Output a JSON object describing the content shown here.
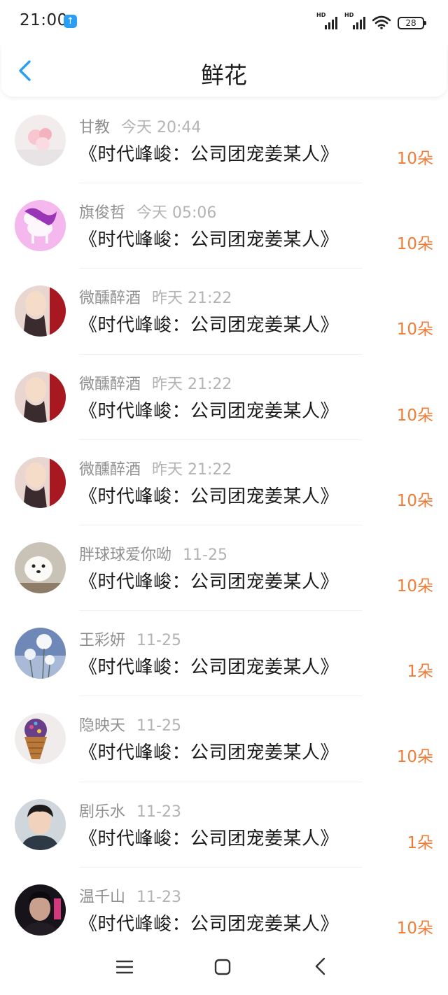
{
  "status_bar": {
    "time": "21:00",
    "signal_1": "HD",
    "signal_2": "HD",
    "battery": "28"
  },
  "header": {
    "title": "鲜花"
  },
  "items": [
    {
      "user": "甘教",
      "time": "今天 20:44",
      "book": "《时代峰峻：公司团宠姜某人》",
      "count": "10朵"
    },
    {
      "user": "旗俊哲",
      "time": "今天 05:06",
      "book": "《时代峰峻：公司团宠姜某人》",
      "count": "10朵"
    },
    {
      "user": "微醺醉酒",
      "time": "昨天 21:22",
      "book": "《时代峰峻：公司团宠姜某人》",
      "count": "10朵"
    },
    {
      "user": "微醺醉酒",
      "time": "昨天 21:22",
      "book": "《时代峰峻：公司团宠姜某人》",
      "count": "10朵"
    },
    {
      "user": "微醺醉酒",
      "time": "昨天 21:22",
      "book": "《时代峰峻：公司团宠姜某人》",
      "count": "10朵"
    },
    {
      "user": "胖球球爱你呦",
      "time": "11-25",
      "book": "《时代峰峻：公司团宠姜某人》",
      "count": "10朵"
    },
    {
      "user": "王彩妍",
      "time": "11-25",
      "book": "《时代峰峻：公司团宠姜某人》",
      "count": "1朵"
    },
    {
      "user": "隐映天",
      "time": "11-25",
      "book": "《时代峰峻：公司团宠姜某人》",
      "count": "10朵"
    },
    {
      "user": "剧乐水",
      "time": "11-23",
      "book": "《时代峰峻：公司团宠姜某人》",
      "count": "1朵"
    },
    {
      "user": "温千山",
      "time": "11-23",
      "book": "《时代峰峻：公司团宠姜某人》",
      "count": "10朵"
    }
  ],
  "colors": {
    "accent": "#2a9df4",
    "count": "#ee7b36",
    "name": "#8f8f8f",
    "time": "#b3b3b3"
  },
  "icons": {
    "back": "chevron-left-icon",
    "nav_menu": "menu-icon",
    "nav_home": "square-icon",
    "nav_back": "chevron-left-icon"
  }
}
